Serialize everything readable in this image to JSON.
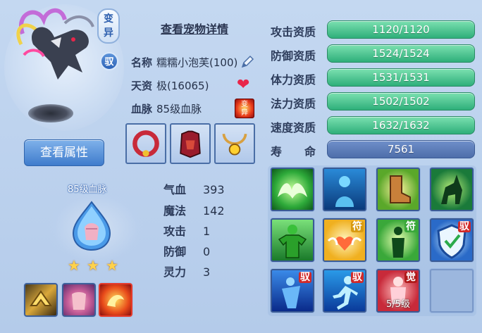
{
  "pet": {
    "badge_mutant": "变异",
    "badge_tame": "驭",
    "view_attr_button": "查看属性"
  },
  "details": {
    "title": "查看宠物详情",
    "name_label": "名称",
    "name_value": "糯糯小泡芙(100)",
    "aptitude_label": "天资",
    "aptitude_value": "极(16065)",
    "bloodline_label": "血脉",
    "bloodline_value": "85级血脉",
    "mutate_icon_text": "变异"
  },
  "bloodline": {
    "title": "85级血脉",
    "stars": [
      "★",
      "★",
      "★"
    ]
  },
  "stats": [
    {
      "label": "气血",
      "value": "393"
    },
    {
      "label": "魔法",
      "value": "142"
    },
    {
      "label": "攻击",
      "value": "1"
    },
    {
      "label": "防御",
      "value": "0"
    },
    {
      "label": "灵力",
      "value": "3"
    }
  ],
  "aptitudes": [
    {
      "label": "攻击资质",
      "value": "1120/1120",
      "fill": 1.0
    },
    {
      "label": "防御资质",
      "value": "1524/1524",
      "fill": 1.0
    },
    {
      "label": "体力资质",
      "value": "1531/1531",
      "fill": 1.0
    },
    {
      "label": "法力资质",
      "value": "1502/1502",
      "fill": 1.0
    },
    {
      "label": "速度资质",
      "value": "1632/1632",
      "fill": 1.0
    },
    {
      "label": "寿　　命",
      "value": "7561",
      "fill": 1.0
    }
  ],
  "skills": [
    {
      "name": "wings",
      "tag": ""
    },
    {
      "name": "spirit",
      "tag": ""
    },
    {
      "name": "boot",
      "tag": ""
    },
    {
      "name": "stag",
      "tag": ""
    },
    {
      "name": "strength",
      "tag": ""
    },
    {
      "name": "heart-wings",
      "tag": "符"
    },
    {
      "name": "figure",
      "tag": "符"
    },
    {
      "name": "shield",
      "tag": "驭"
    },
    {
      "name": "warrior",
      "tag": "驭"
    },
    {
      "name": "runner",
      "tag": "驭"
    },
    {
      "name": "awaken",
      "tag": "觉",
      "level": "5/5级"
    },
    {
      "name": "empty",
      "tag": ""
    }
  ],
  "colors": {
    "aptitude_bar": "#2eaf7a",
    "lifespan_bar": "#4e6eaa",
    "panel_bg": "#b4cbea"
  }
}
